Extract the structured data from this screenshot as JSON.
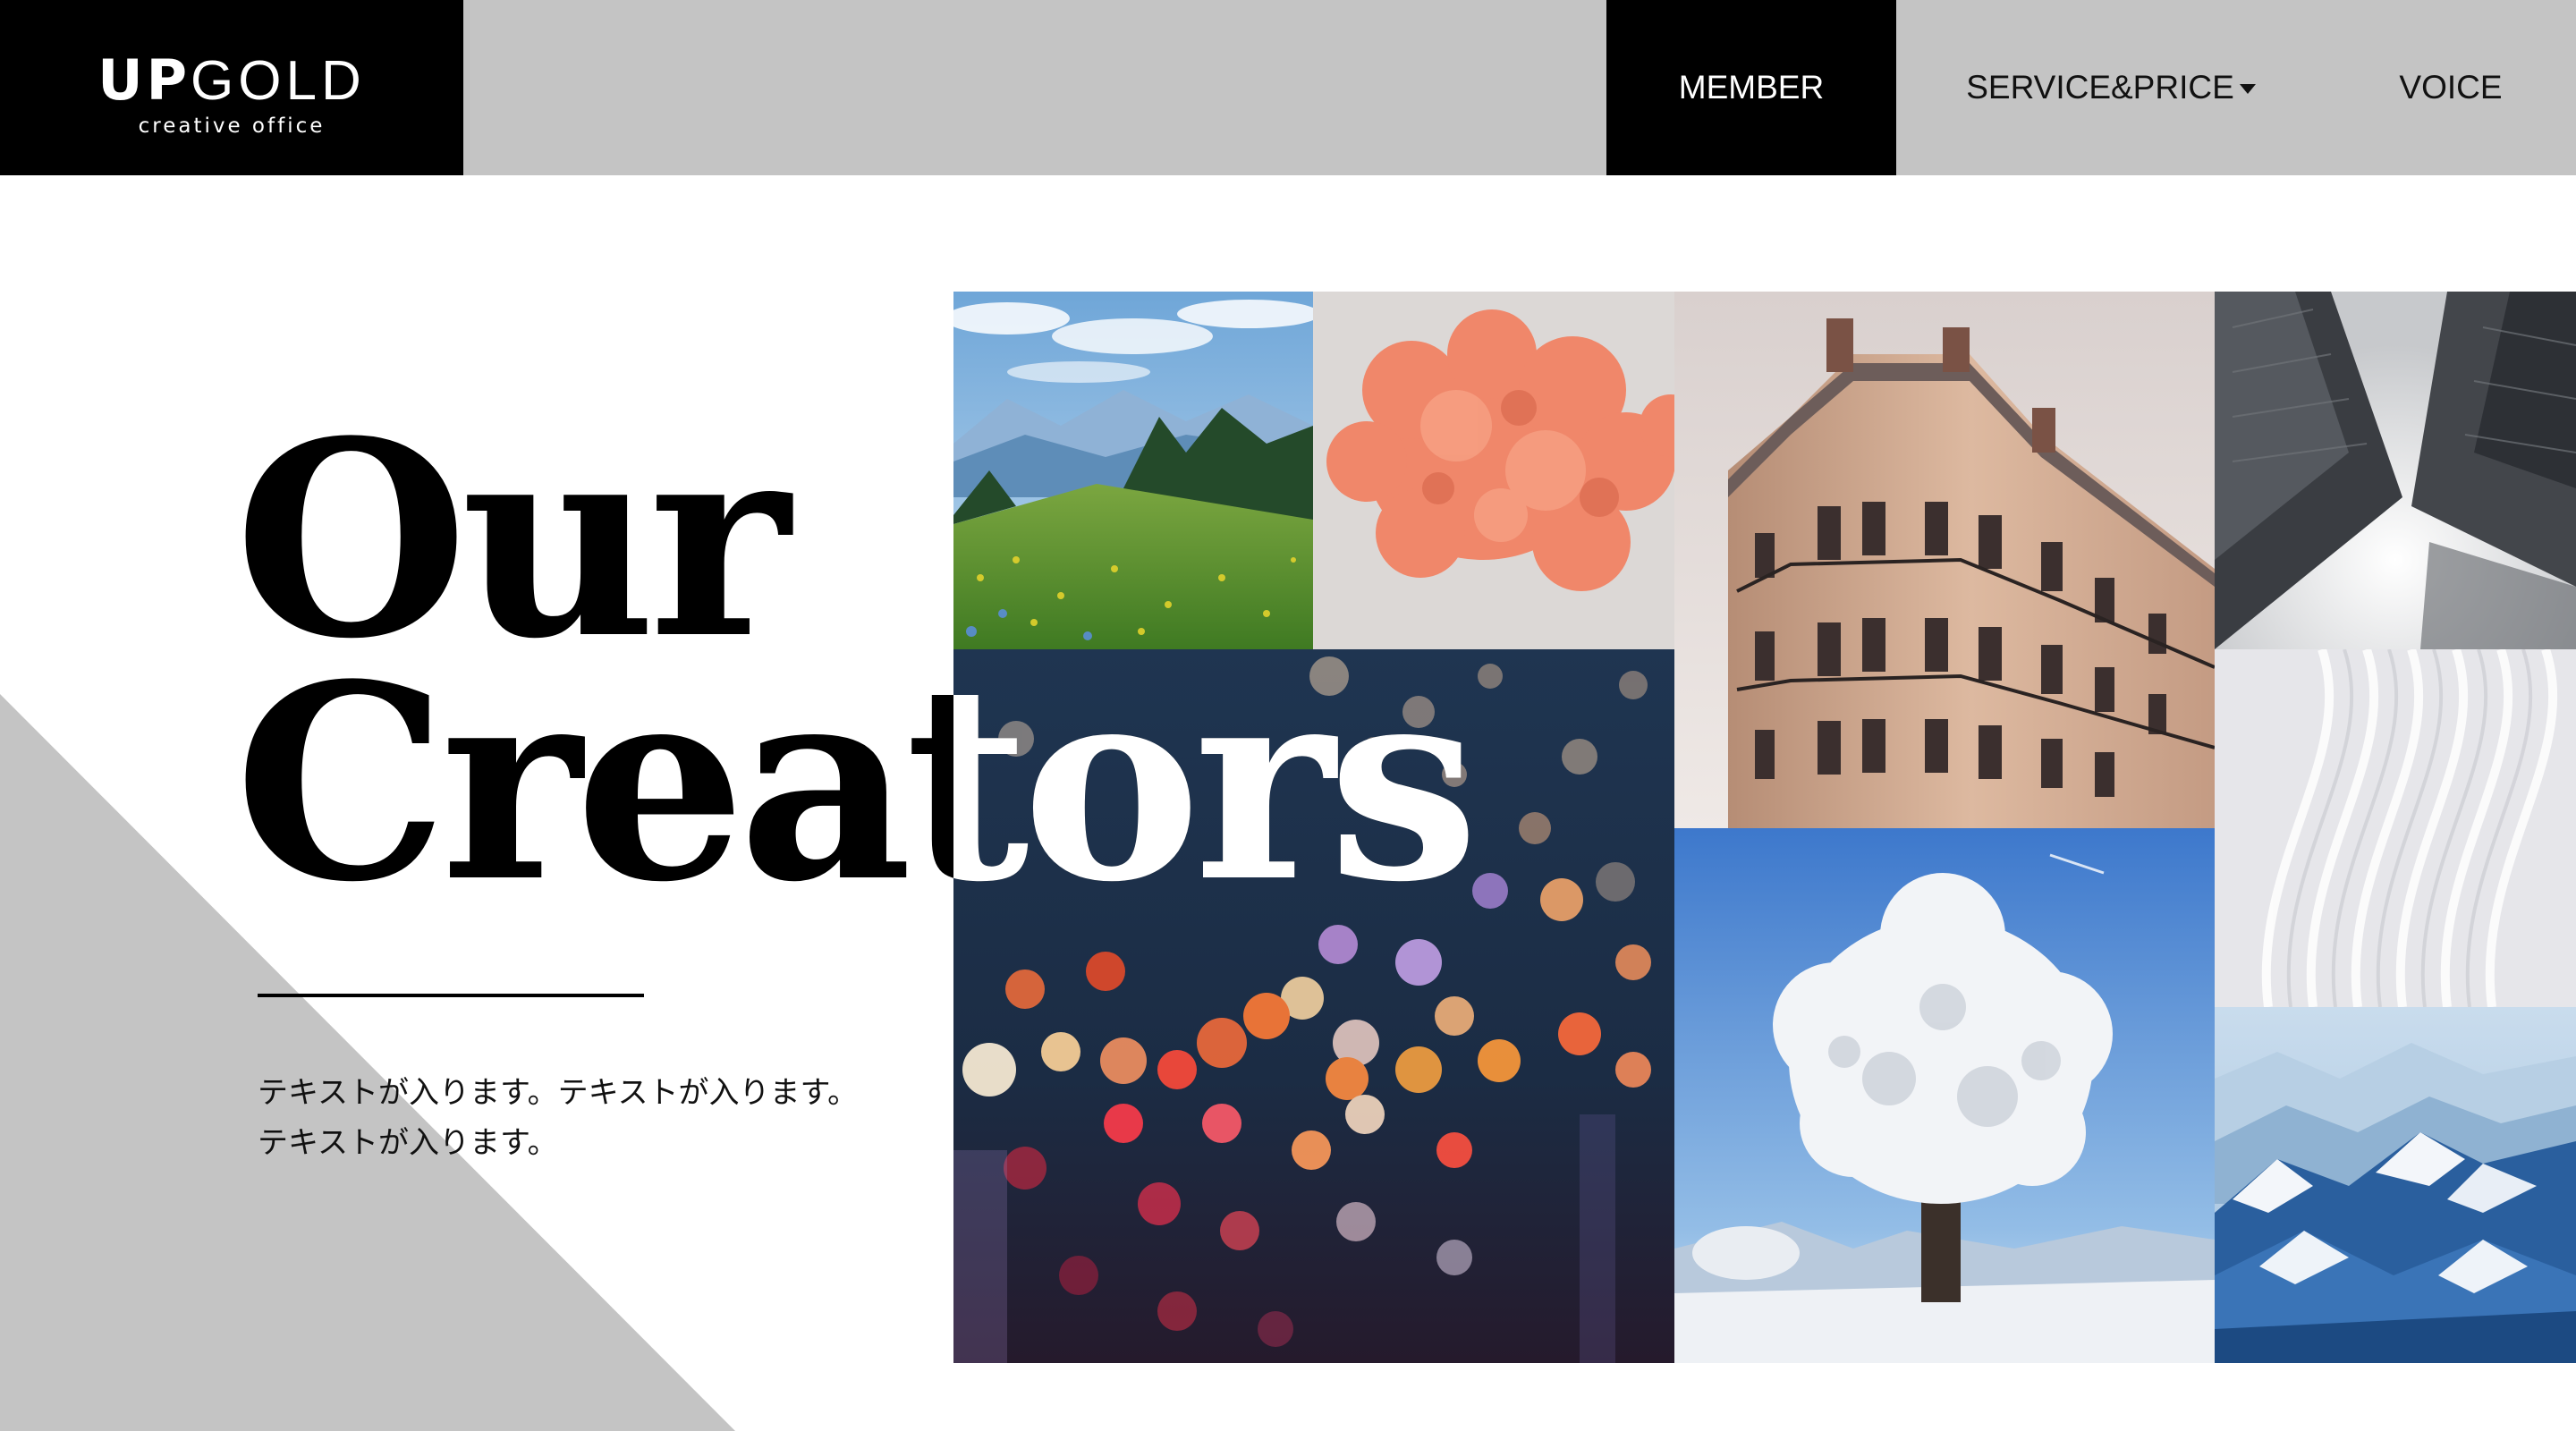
{
  "brand": {
    "name_bold": "UP",
    "name_light": "GOLD",
    "tagline": "creative office"
  },
  "nav": {
    "member": "MEMBER",
    "service_price": "SERVICE&PRICE",
    "voice": "VOICE",
    "active": "MEMBER"
  },
  "hero": {
    "title_line1": "Our",
    "title_line2": "Creators",
    "description_line1": "テキストが入ります。テキストが入ります。",
    "description_line2": "テキストが入ります。"
  },
  "icons": {
    "dropdown": "caret-down-icon"
  },
  "colors": {
    "header_bg": "#c4c4c4",
    "logo_bg": "#000000",
    "active_nav_bg": "#000000",
    "triangle": "#c4c4c4",
    "text": "#111111"
  }
}
